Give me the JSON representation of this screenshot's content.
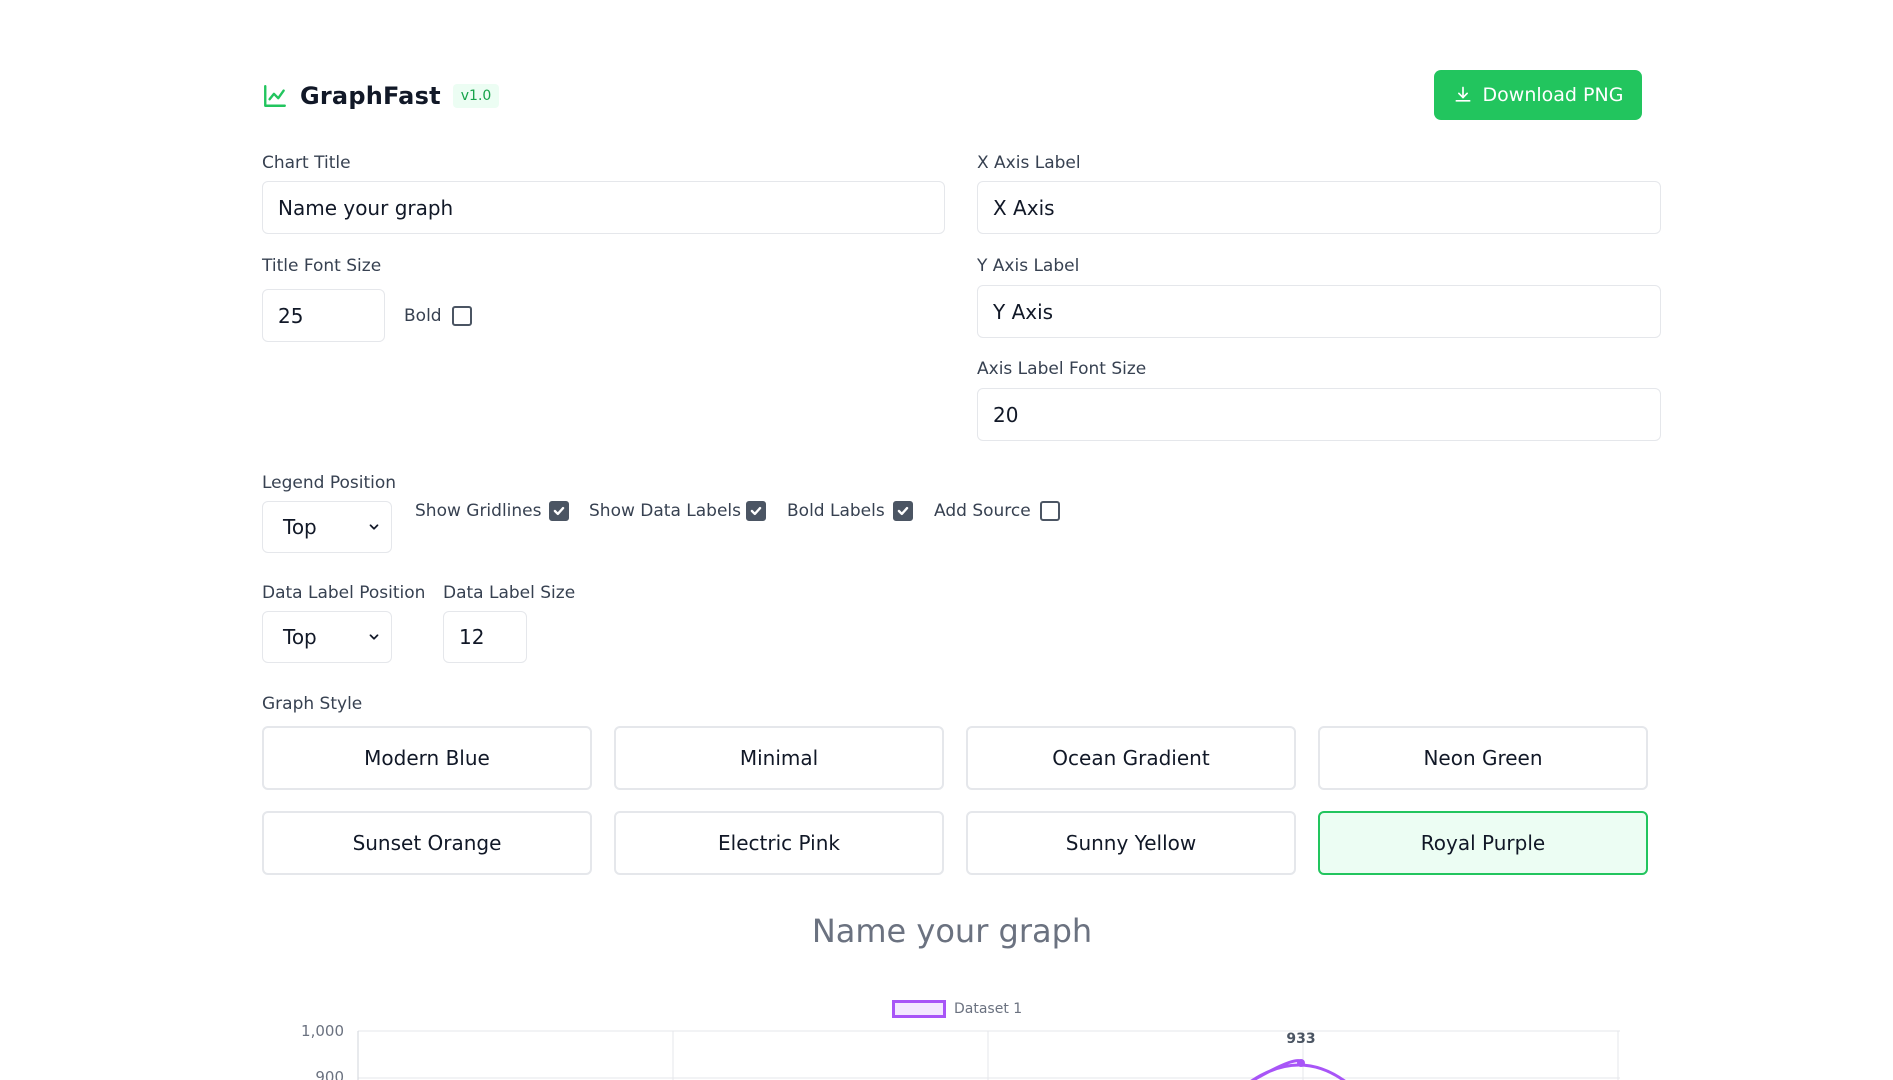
{
  "app": {
    "name": "GraphFast",
    "version": "v1.0",
    "download_label": "Download PNG"
  },
  "form": {
    "chart_title_label": "Chart Title",
    "chart_title_value": "Name your graph",
    "title_font_size_label": "Title Font Size",
    "title_font_size_value": "25",
    "bold_label": "Bold",
    "x_axis_label_label": "X Axis Label",
    "x_axis_label_value": "X Axis",
    "y_axis_label_label": "Y Axis Label",
    "y_axis_label_value": "Y Axis",
    "axis_font_size_label": "Axis Label Font Size",
    "axis_font_size_value": "20",
    "legend_position_label": "Legend Position",
    "legend_position_value": "Top",
    "show_gridlines_label": "Show Gridlines",
    "show_data_labels_label": "Show Data Labels",
    "bold_labels_label": "Bold Labels",
    "add_source_label": "Add Source",
    "data_label_position_label": "Data Label Position",
    "data_label_position_value": "Top",
    "data_label_size_label": "Data Label Size",
    "data_label_size_value": "12"
  },
  "checkboxes": {
    "bold": false,
    "show_gridlines": true,
    "show_data_labels": true,
    "bold_labels": true,
    "add_source": false
  },
  "graph_style": {
    "label": "Graph Style",
    "options": [
      "Modern Blue",
      "Minimal",
      "Ocean Gradient",
      "Neon Green",
      "Sunset Orange",
      "Electric Pink",
      "Sunny Yellow",
      "Royal Purple"
    ],
    "selected": "Royal Purple"
  },
  "colors": {
    "brand_green": "#22c55e",
    "series_purple": "#a855f7"
  },
  "chart_data": {
    "type": "line",
    "title": "Name your graph",
    "legend": "top",
    "grid": true,
    "series": [
      {
        "name": "Dataset 1",
        "peak_label": "933"
      }
    ],
    "y_ticks": [
      "1,000",
      "900"
    ],
    "peak_value": 933,
    "ylim": [
      0,
      1000
    ]
  }
}
